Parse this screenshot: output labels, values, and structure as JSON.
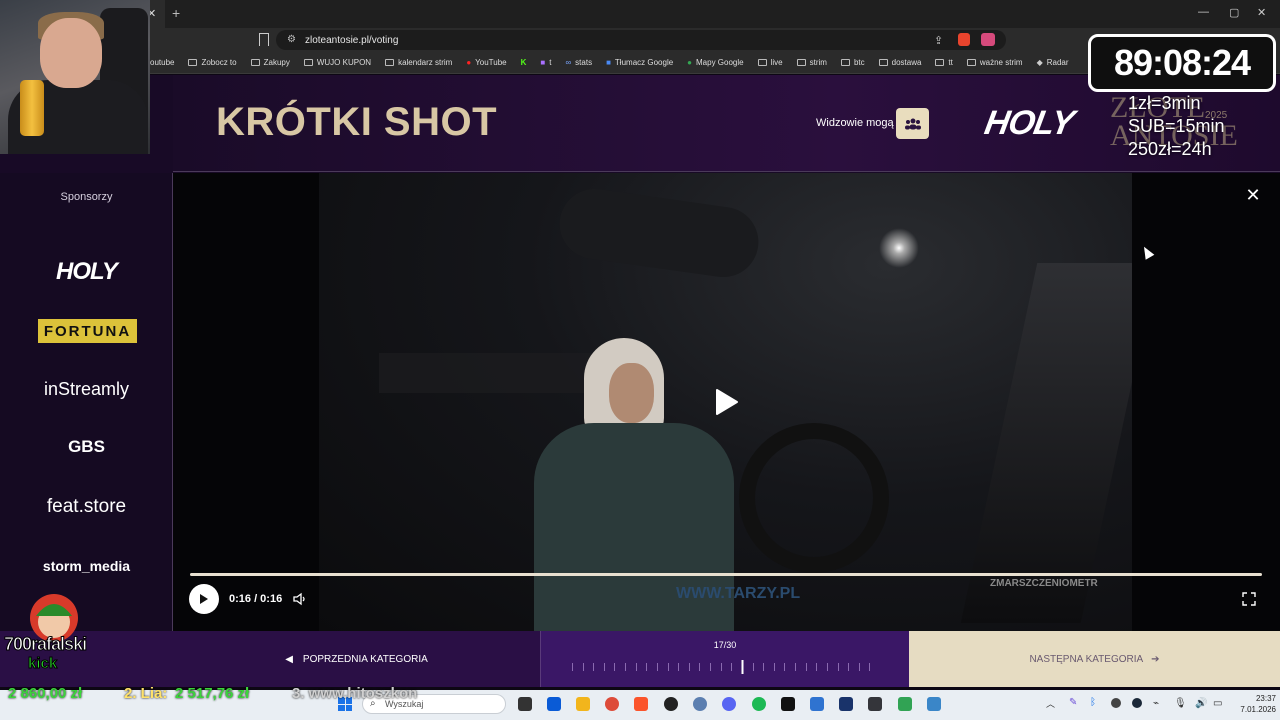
{
  "browser": {
    "url": "zloteantosie.pl/voting",
    "bookmarks": [
      "outube",
      "Zobocz to",
      "Zakupy",
      "WUJO KUPON",
      "kalendarz strim",
      "YouTube",
      "t",
      "stats",
      "Tłumacz Google",
      "Mapy Google",
      "live",
      "strim",
      "btc",
      "dostawa",
      "tt",
      "ważne strim",
      "Radar"
    ]
  },
  "overlay": {
    "timer": "89:08:24",
    "rates": [
      "1zł=3min",
      "SUB=15min",
      "250zł=24h"
    ]
  },
  "header": {
    "title": "KRÓTKI SHOT",
    "viewers_label": "Widzowie mogą",
    "holy_logo": "HOLY",
    "golden_logo_line1": "ZŁOTE",
    "golden_logo_line2": "ANTOSIE",
    "golden_logo_year": "2025"
  },
  "sidebar": {
    "label": "Sponsorzy",
    "sponsors": [
      "HOLY",
      "FORTUNA",
      "inStreamly",
      "GBS",
      "feat.store",
      "storm_media"
    ]
  },
  "player": {
    "time": "0:16 / 0:16",
    "progress": 1.0,
    "watermark": "WWW.TARZY.PL",
    "watermark2": "ZMARSZCZENIOMETR"
  },
  "nav": {
    "prev_label": "POPRZEDNIA KATEGORIA",
    "next_label": "NASTĘPNA KATEGORIA",
    "counter": "17/30",
    "current": 17,
    "total": 30
  },
  "streamer": {
    "name": "700rafalski",
    "platform": "kick"
  },
  "ticker": {
    "items": [
      "2 860,00 zł",
      "2. Lia:",
      "2 517,76 zł",
      "3. www.hitoszkon"
    ]
  },
  "taskbar": {
    "search_placeholder": "Wyszukaj",
    "time": "23:37",
    "date": "7.01.2026"
  }
}
